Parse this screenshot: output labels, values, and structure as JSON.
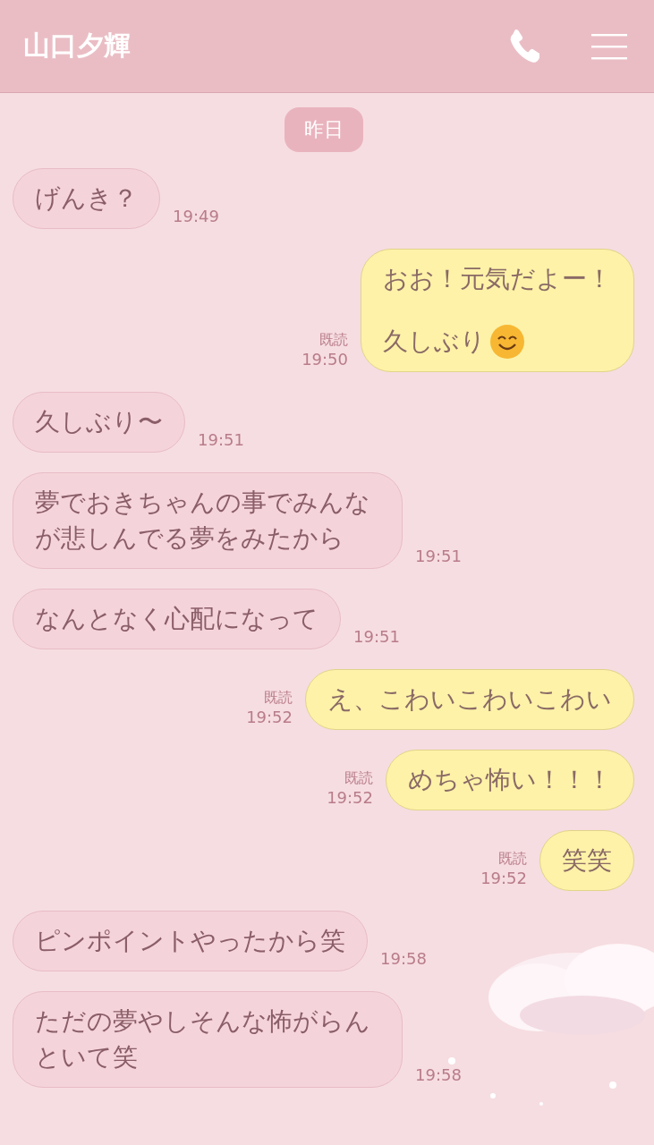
{
  "header": {
    "title": "山口夕輝"
  },
  "chat": {
    "date_label": "昨日",
    "messages": [
      {
        "kind": "incoming",
        "lines": [
          "げんき？"
        ],
        "time": "19:49"
      },
      {
        "kind": "outgoing",
        "lines": [
          "おお！元気だよー！",
          "久しぶり"
        ],
        "smiley": true,
        "read": "既読",
        "time": "19:50"
      },
      {
        "kind": "incoming",
        "lines": [
          "久しぶり〜"
        ],
        "time": "19:51"
      },
      {
        "kind": "incoming",
        "lines": [
          "夢でおきちゃんの事でみんなが悲しんでる夢をみたから"
        ],
        "time": "19:51"
      },
      {
        "kind": "incoming",
        "lines": [
          "なんとなく心配になって"
        ],
        "time": "19:51"
      },
      {
        "kind": "outgoing",
        "lines": [
          "え、こわいこわいこわい"
        ],
        "read": "既読",
        "time": "19:52"
      },
      {
        "kind": "outgoing",
        "lines": [
          "めちゃ怖い！！！"
        ],
        "read": "既読",
        "time": "19:52"
      },
      {
        "kind": "outgoing",
        "lines": [
          "笑笑"
        ],
        "read": "既読",
        "time": "19:52"
      },
      {
        "kind": "incoming",
        "lines": [
          "ピンポイントやったから笑"
        ],
        "time": "19:58"
      },
      {
        "kind": "incoming",
        "lines": [
          "ただの夢やしそんな怖がらんといて笑"
        ],
        "time": "19:58"
      }
    ]
  }
}
